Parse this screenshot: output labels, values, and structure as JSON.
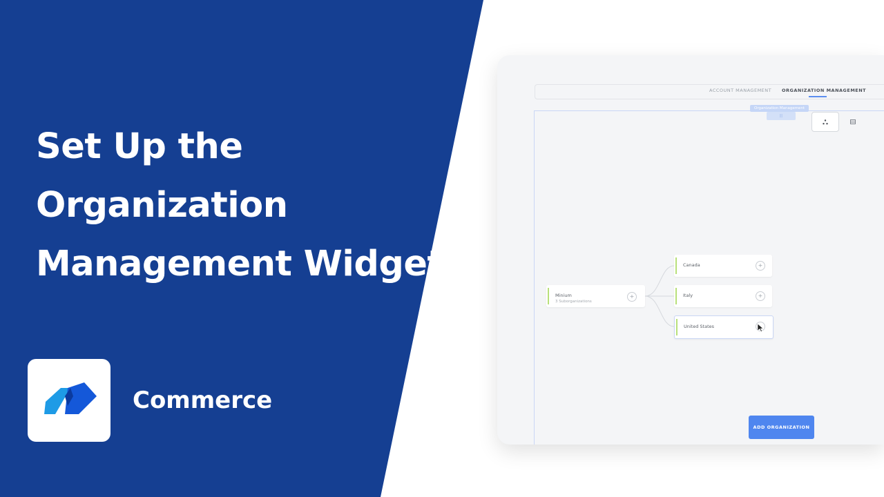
{
  "title_lines": [
    "Set Up the",
    "Organization",
    "Management Widget"
  ],
  "brand": {
    "name": "Commerce",
    "icon": "commerce-logo-icon",
    "colors": {
      "light": "#1e9be6",
      "dark": "#1458d9",
      "overlap": "#0b3a9e"
    }
  },
  "panel_color": "#153f92",
  "screenshot": {
    "tabs": [
      {
        "label": "ACCOUNT MANAGEMENT",
        "active": false
      },
      {
        "label": "ORGANIZATION MANAGEMENT",
        "active": true
      }
    ],
    "frame_label": "Organization Management",
    "frame_label_sub": "|||",
    "view_buttons": [
      "tree-view-icon",
      "grid-view-icon"
    ],
    "root": {
      "name": "Minium",
      "sub": "3 Suborganizations"
    },
    "children": [
      {
        "name": "Canada"
      },
      {
        "name": "Italy"
      },
      {
        "name": "United States"
      }
    ],
    "plus": "+",
    "add_button": "ADD ORGANIZATION",
    "accent": "#4f86ef",
    "node_bar": "#b8e07a"
  }
}
